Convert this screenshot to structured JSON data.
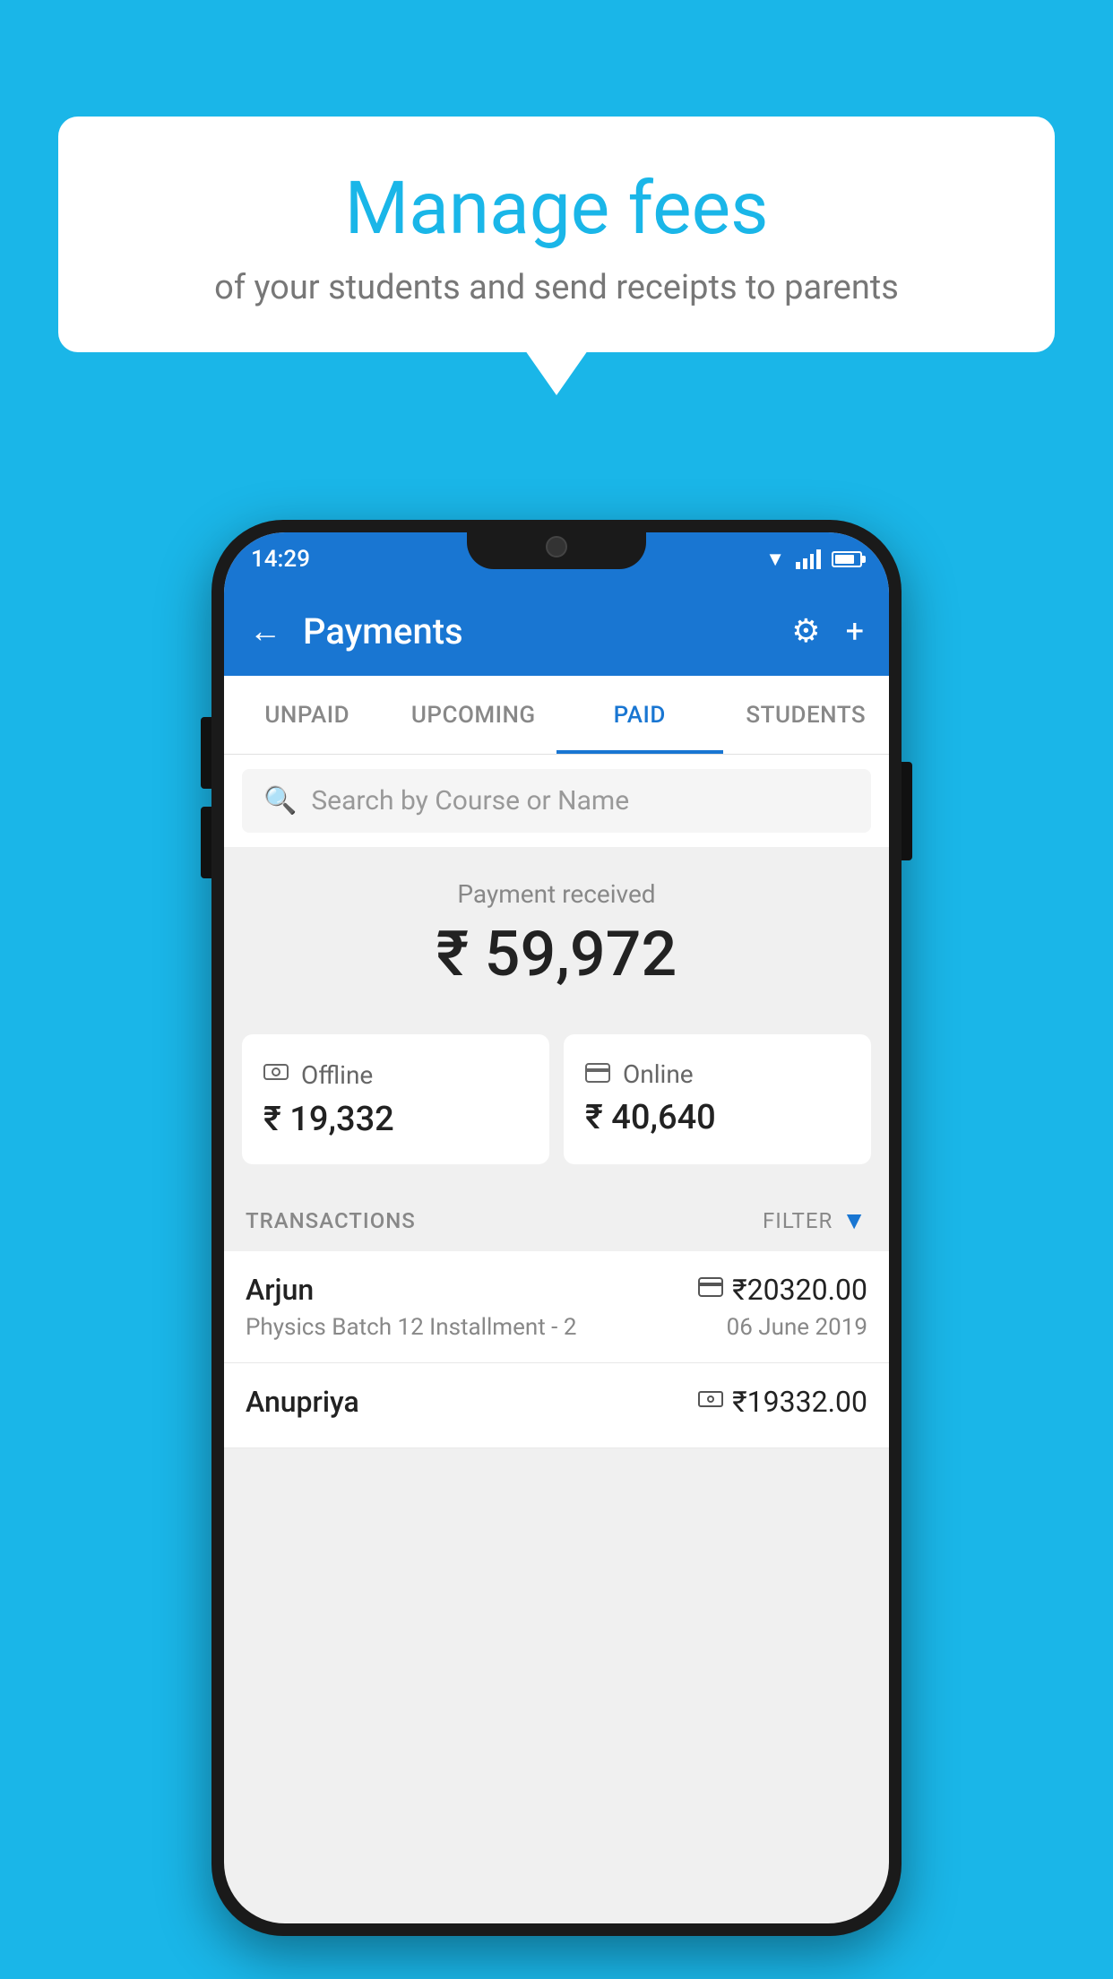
{
  "background_color": "#1ab6e8",
  "speech_bubble": {
    "title": "Manage fees",
    "subtitle": "of your students and send receipts to parents"
  },
  "status_bar": {
    "time": "14:29"
  },
  "header": {
    "title": "Payments",
    "back_label": "←",
    "gear_label": "⚙",
    "plus_label": "+"
  },
  "tabs": [
    {
      "id": "unpaid",
      "label": "UNPAID",
      "active": false
    },
    {
      "id": "upcoming",
      "label": "UPCOMING",
      "active": false
    },
    {
      "id": "paid",
      "label": "PAID",
      "active": true
    },
    {
      "id": "students",
      "label": "STUDENTS",
      "active": false
    }
  ],
  "search": {
    "placeholder": "Search by Course or Name"
  },
  "payment": {
    "label": "Payment received",
    "amount": "₹ 59,972",
    "offline_label": "Offline",
    "offline_amount": "₹ 19,332",
    "online_label": "Online",
    "online_amount": "₹ 40,640"
  },
  "transactions": {
    "label": "TRANSACTIONS",
    "filter_label": "FILTER"
  },
  "transaction_list": [
    {
      "name": "Arjun",
      "detail": "Physics Batch 12 Installment - 2",
      "amount": "₹20320.00",
      "date": "06 June 2019",
      "method": "card"
    },
    {
      "name": "Anupriya",
      "detail": "",
      "amount": "₹19332.00",
      "date": "",
      "method": "cash"
    }
  ]
}
